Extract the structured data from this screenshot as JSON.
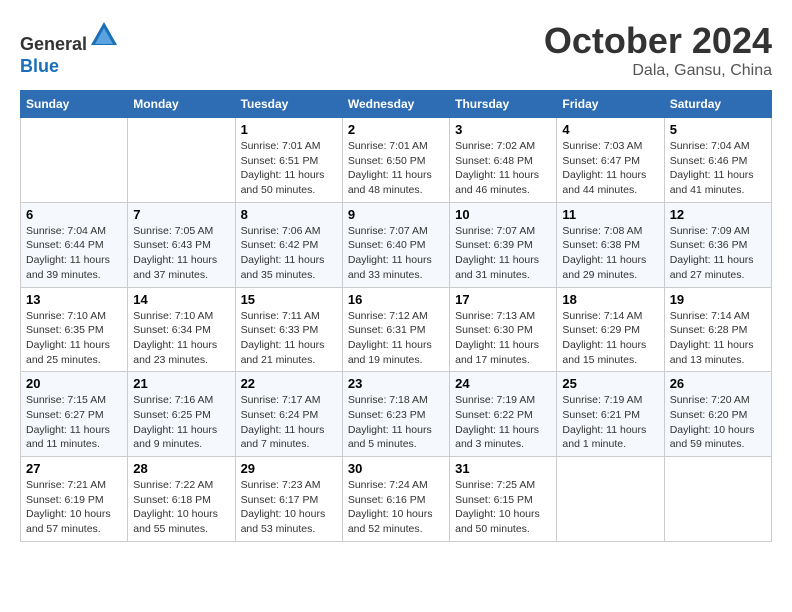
{
  "header": {
    "logo_line1": "General",
    "logo_line2": "Blue",
    "month": "October 2024",
    "location": "Dala, Gansu, China"
  },
  "weekdays": [
    "Sunday",
    "Monday",
    "Tuesday",
    "Wednesday",
    "Thursday",
    "Friday",
    "Saturday"
  ],
  "weeks": [
    [
      {
        "day": "",
        "info": ""
      },
      {
        "day": "",
        "info": ""
      },
      {
        "day": "1",
        "info": "Sunrise: 7:01 AM\nSunset: 6:51 PM\nDaylight: 11 hours and 50 minutes."
      },
      {
        "day": "2",
        "info": "Sunrise: 7:01 AM\nSunset: 6:50 PM\nDaylight: 11 hours and 48 minutes."
      },
      {
        "day": "3",
        "info": "Sunrise: 7:02 AM\nSunset: 6:48 PM\nDaylight: 11 hours and 46 minutes."
      },
      {
        "day": "4",
        "info": "Sunrise: 7:03 AM\nSunset: 6:47 PM\nDaylight: 11 hours and 44 minutes."
      },
      {
        "day": "5",
        "info": "Sunrise: 7:04 AM\nSunset: 6:46 PM\nDaylight: 11 hours and 41 minutes."
      }
    ],
    [
      {
        "day": "6",
        "info": "Sunrise: 7:04 AM\nSunset: 6:44 PM\nDaylight: 11 hours and 39 minutes."
      },
      {
        "day": "7",
        "info": "Sunrise: 7:05 AM\nSunset: 6:43 PM\nDaylight: 11 hours and 37 minutes."
      },
      {
        "day": "8",
        "info": "Sunrise: 7:06 AM\nSunset: 6:42 PM\nDaylight: 11 hours and 35 minutes."
      },
      {
        "day": "9",
        "info": "Sunrise: 7:07 AM\nSunset: 6:40 PM\nDaylight: 11 hours and 33 minutes."
      },
      {
        "day": "10",
        "info": "Sunrise: 7:07 AM\nSunset: 6:39 PM\nDaylight: 11 hours and 31 minutes."
      },
      {
        "day": "11",
        "info": "Sunrise: 7:08 AM\nSunset: 6:38 PM\nDaylight: 11 hours and 29 minutes."
      },
      {
        "day": "12",
        "info": "Sunrise: 7:09 AM\nSunset: 6:36 PM\nDaylight: 11 hours and 27 minutes."
      }
    ],
    [
      {
        "day": "13",
        "info": "Sunrise: 7:10 AM\nSunset: 6:35 PM\nDaylight: 11 hours and 25 minutes."
      },
      {
        "day": "14",
        "info": "Sunrise: 7:10 AM\nSunset: 6:34 PM\nDaylight: 11 hours and 23 minutes."
      },
      {
        "day": "15",
        "info": "Sunrise: 7:11 AM\nSunset: 6:33 PM\nDaylight: 11 hours and 21 minutes."
      },
      {
        "day": "16",
        "info": "Sunrise: 7:12 AM\nSunset: 6:31 PM\nDaylight: 11 hours and 19 minutes."
      },
      {
        "day": "17",
        "info": "Sunrise: 7:13 AM\nSunset: 6:30 PM\nDaylight: 11 hours and 17 minutes."
      },
      {
        "day": "18",
        "info": "Sunrise: 7:14 AM\nSunset: 6:29 PM\nDaylight: 11 hours and 15 minutes."
      },
      {
        "day": "19",
        "info": "Sunrise: 7:14 AM\nSunset: 6:28 PM\nDaylight: 11 hours and 13 minutes."
      }
    ],
    [
      {
        "day": "20",
        "info": "Sunrise: 7:15 AM\nSunset: 6:27 PM\nDaylight: 11 hours and 11 minutes."
      },
      {
        "day": "21",
        "info": "Sunrise: 7:16 AM\nSunset: 6:25 PM\nDaylight: 11 hours and 9 minutes."
      },
      {
        "day": "22",
        "info": "Sunrise: 7:17 AM\nSunset: 6:24 PM\nDaylight: 11 hours and 7 minutes."
      },
      {
        "day": "23",
        "info": "Sunrise: 7:18 AM\nSunset: 6:23 PM\nDaylight: 11 hours and 5 minutes."
      },
      {
        "day": "24",
        "info": "Sunrise: 7:19 AM\nSunset: 6:22 PM\nDaylight: 11 hours and 3 minutes."
      },
      {
        "day": "25",
        "info": "Sunrise: 7:19 AM\nSunset: 6:21 PM\nDaylight: 11 hours and 1 minute."
      },
      {
        "day": "26",
        "info": "Sunrise: 7:20 AM\nSunset: 6:20 PM\nDaylight: 10 hours and 59 minutes."
      }
    ],
    [
      {
        "day": "27",
        "info": "Sunrise: 7:21 AM\nSunset: 6:19 PM\nDaylight: 10 hours and 57 minutes."
      },
      {
        "day": "28",
        "info": "Sunrise: 7:22 AM\nSunset: 6:18 PM\nDaylight: 10 hours and 55 minutes."
      },
      {
        "day": "29",
        "info": "Sunrise: 7:23 AM\nSunset: 6:17 PM\nDaylight: 10 hours and 53 minutes."
      },
      {
        "day": "30",
        "info": "Sunrise: 7:24 AM\nSunset: 6:16 PM\nDaylight: 10 hours and 52 minutes."
      },
      {
        "day": "31",
        "info": "Sunrise: 7:25 AM\nSunset: 6:15 PM\nDaylight: 10 hours and 50 minutes."
      },
      {
        "day": "",
        "info": ""
      },
      {
        "day": "",
        "info": ""
      }
    ]
  ]
}
